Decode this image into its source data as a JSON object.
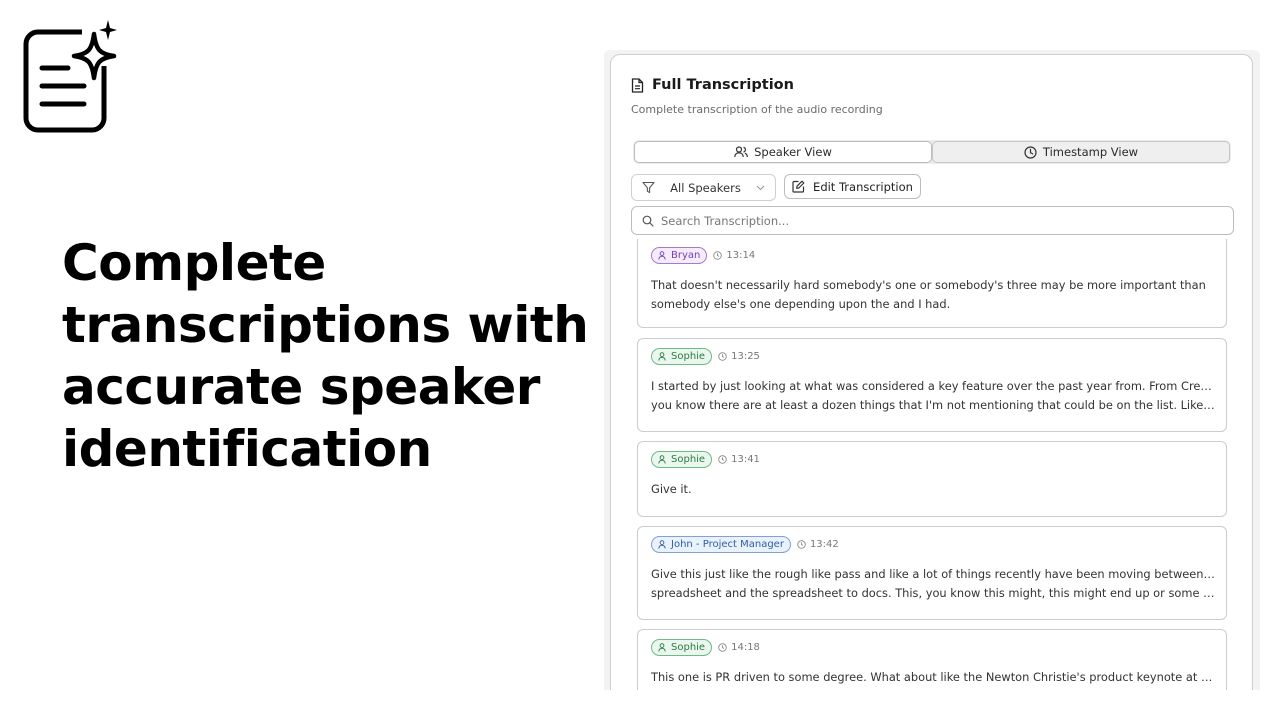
{
  "hero": {
    "headline_lines": [
      "Complete",
      "transcriptions with",
      "accurate speaker",
      "identification"
    ]
  },
  "panel": {
    "title": "Full Transcription",
    "subtitle": "Complete transcription of the audio recording",
    "view_tabs": [
      {
        "label": "Speaker View",
        "icon": "users-icon",
        "active": true
      },
      {
        "label": "Timestamp View",
        "icon": "clock-icon",
        "active": false
      }
    ],
    "filter_label": "All Speakers",
    "edit_label": "Edit Transcription",
    "search_placeholder": "Search Transcription..."
  },
  "colors": {
    "purple_badge": "#7a3fae",
    "green_badge": "#2c7a43",
    "blue_badge": "#2f5fa5"
  },
  "entries": [
    {
      "speaker": "Bryan",
      "time": "13:14",
      "color": "purple",
      "lines": [
        "That doesn't necessarily hard somebody's one or somebody's three may be more important than",
        "somebody else's one depending upon the and I had."
      ]
    },
    {
      "speaker": "Sophie",
      "time": "13:25",
      "color": "green",
      "lines": [
        "I started by just looking at what was considered a key feature over the past year from. From Create and",
        "you know there are at least a dozen things that I'm not mentioning that could be on the list. Like I could..."
      ]
    },
    {
      "speaker": "Sophie",
      "time": "13:41",
      "color": "green",
      "lines": [
        "Give it."
      ]
    },
    {
      "speaker": "John - Project Manager",
      "time": "13:42",
      "color": "blue",
      "lines": [
        "Give this just like the rough like pass and like a lot of things recently have been moving between docs and",
        "spreadsheet and the spreadsheet to docs. This, you know this might, this might end up or some iteratio..."
      ]
    },
    {
      "speaker": "Sophie",
      "time": "14:18",
      "color": "green",
      "lines": [
        "This one is PR driven to some degree. What about like the Newton Christie's product keynote at Commit?"
      ]
    }
  ]
}
